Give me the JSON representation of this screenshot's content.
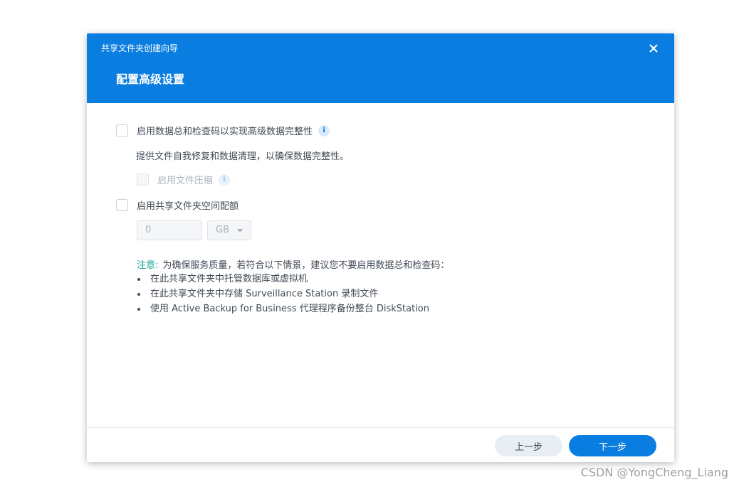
{
  "header": {
    "wizard_title": "共享文件夹创建向导",
    "step_title": "配置高级设置"
  },
  "options": {
    "checksum_label": "启用数据总和检查码以实现高级数据完整性",
    "checksum_description": "提供文件自我修复和数据清理，以确保数据完整性。",
    "compression_label": "启用文件压缩",
    "quota_label": "启用共享文件夹空间配额",
    "quota_value": "0",
    "quota_unit": "GB"
  },
  "note": {
    "label": "注意:",
    "text": "为确保服务质量，若符合以下情景，建议您不要启用数据总和检查码：",
    "items": [
      "在此共享文件夹中托管数据库或虚拟机",
      "在此共享文件夹中存储 Surveillance Station 录制文件",
      "使用 Active Backup for Business 代理程序备份整台 DiskStation"
    ]
  },
  "footer": {
    "prev_label": "上一步",
    "next_label": "下一步"
  },
  "info_icon_glyph": "i",
  "watermark": "CSDN @YongCheng_Liang",
  "colors": {
    "header_bg": "#0a7de0",
    "primary_button": "#0a7de0",
    "note_label": "#1aa39a"
  }
}
